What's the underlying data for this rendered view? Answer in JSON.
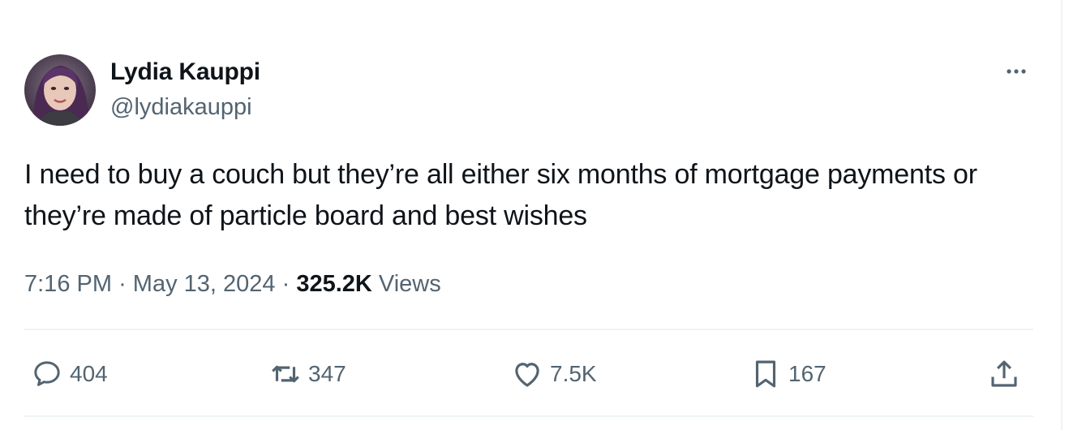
{
  "tweet": {
    "author": {
      "display_name": "Lydia Kauppi",
      "handle": "@lydiakauppi"
    },
    "text": "I need to buy a couch but they’re all either six months of mortgage payments or they’re made of particle board and best wishes",
    "meta": {
      "time": "7:16 PM",
      "separator": "·",
      "date": "May 13, 2024",
      "views_count": "325.2K",
      "views_label": "Views"
    },
    "actions": {
      "replies": "404",
      "reposts": "347",
      "likes": "7.5K",
      "bookmarks": "167"
    }
  },
  "icons": {
    "more": "more-dots-icon",
    "reply": "reply-bubble-icon",
    "repost": "repost-arrows-icon",
    "like": "heart-icon",
    "bookmark": "bookmark-icon",
    "share": "share-upload-icon"
  },
  "colors": {
    "text_primary": "#0f1419",
    "text_secondary": "#536471",
    "divider": "#eff3f4"
  }
}
